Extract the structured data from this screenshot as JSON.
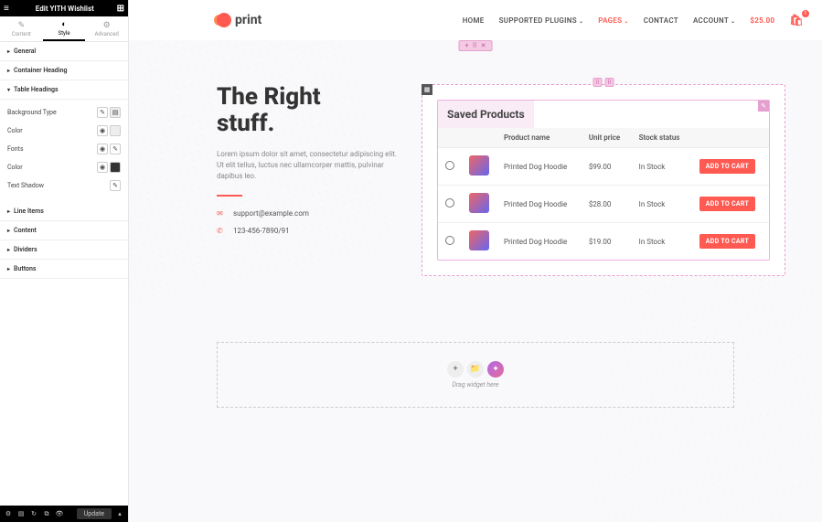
{
  "editor": {
    "title": "Edit YITH Wishlist",
    "tabs": [
      "Content",
      "Style",
      "Advanced"
    ],
    "active_tab": "Style",
    "sections": {
      "general": "General",
      "container_heading": "Container Heading",
      "table_headings": "Table Headings",
      "line_items": "Line Items",
      "content": "Content",
      "dividers": "Dividers",
      "buttons": "Buttons"
    },
    "table_headings_panel": {
      "background_type": "Background Type",
      "color": "Color",
      "fonts": "Fonts",
      "color2": "Color",
      "text_shadow": "Text Shadow"
    },
    "footer": {
      "update": "Update"
    }
  },
  "site": {
    "logo_text": "print",
    "nav": {
      "home": "HOME",
      "supported": "SUPPORTED PLUGINS",
      "pages": "PAGES",
      "contact": "CONTACT",
      "account": "ACCOUNT"
    },
    "cart_total": "$25.00",
    "cart_count": "1"
  },
  "hero": {
    "title_l1": "The Right",
    "title_l2": "stuff.",
    "body": "Lorem ipsum dolor sit amet, consectetur adipiscing elit. Ut elit tellus, luctus nec ullamcorper mattis, pulvinar dapibus leo.",
    "email": "support@example.com",
    "phone": "123-456-7890/91"
  },
  "wishlist": {
    "title": "Saved Products",
    "headers": {
      "product": "Product name",
      "price": "Unit price",
      "stock": "Stock status"
    },
    "rows": [
      {
        "name": "Printed Dog Hoodie",
        "price": "$99.00",
        "stock": "In Stock",
        "cta": "ADD TO CART"
      },
      {
        "name": "Printed Dog Hoodie",
        "price": "$28.00",
        "stock": "In Stock",
        "cta": "ADD TO CART"
      },
      {
        "name": "Printed Dog Hoodie",
        "price": "$19.00",
        "stock": "In Stock",
        "cta": "ADD TO CART"
      }
    ]
  },
  "dropzone": {
    "hint": "Drag widget here"
  }
}
